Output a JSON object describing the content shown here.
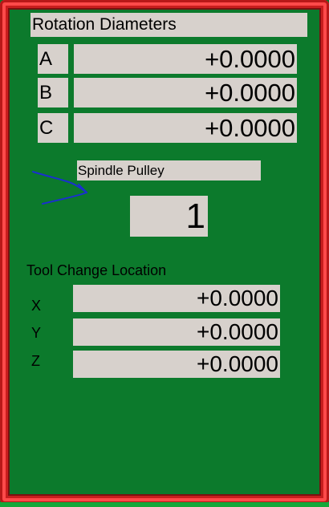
{
  "rotation": {
    "title": "Rotation Diameters",
    "axes": [
      {
        "label": "A",
        "value": "+0.0000"
      },
      {
        "label": "B",
        "value": "+0.0000"
      },
      {
        "label": "C",
        "value": "+0.0000"
      }
    ]
  },
  "spindle": {
    "title": "Spindle Pulley",
    "value": "1"
  },
  "tool_change": {
    "title": "Tool Change Location",
    "axes": [
      {
        "label": "X",
        "value": "+0.0000"
      },
      {
        "label": "Y",
        "value": "+0.0000"
      },
      {
        "label": "Z",
        "value": "+0.0000"
      }
    ]
  },
  "colors": {
    "background": "#0c7a2c",
    "frame": "#e03030",
    "field": "#d7d1cc",
    "arrow": "#1a2fd0"
  }
}
